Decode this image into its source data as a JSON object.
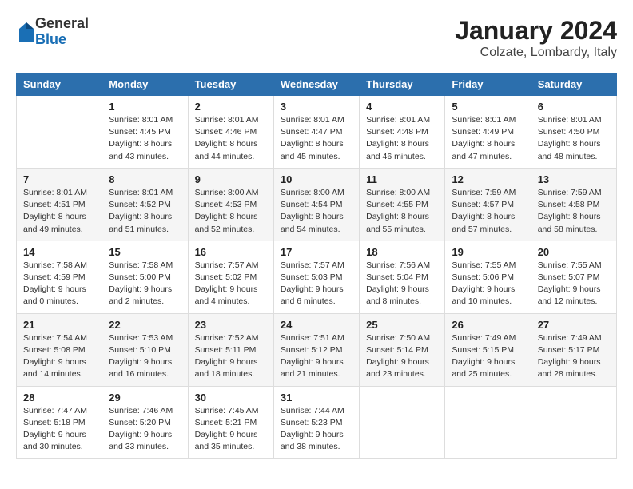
{
  "header": {
    "logo_general": "General",
    "logo_blue": "Blue",
    "title": "January 2024",
    "subtitle": "Colzate, Lombardy, Italy"
  },
  "days_of_week": [
    "Sunday",
    "Monday",
    "Tuesday",
    "Wednesday",
    "Thursday",
    "Friday",
    "Saturday"
  ],
  "weeks": [
    [
      {
        "day": "",
        "info": ""
      },
      {
        "day": "1",
        "info": "Sunrise: 8:01 AM\nSunset: 4:45 PM\nDaylight: 8 hours\nand 43 minutes."
      },
      {
        "day": "2",
        "info": "Sunrise: 8:01 AM\nSunset: 4:46 PM\nDaylight: 8 hours\nand 44 minutes."
      },
      {
        "day": "3",
        "info": "Sunrise: 8:01 AM\nSunset: 4:47 PM\nDaylight: 8 hours\nand 45 minutes."
      },
      {
        "day": "4",
        "info": "Sunrise: 8:01 AM\nSunset: 4:48 PM\nDaylight: 8 hours\nand 46 minutes."
      },
      {
        "day": "5",
        "info": "Sunrise: 8:01 AM\nSunset: 4:49 PM\nDaylight: 8 hours\nand 47 minutes."
      },
      {
        "day": "6",
        "info": "Sunrise: 8:01 AM\nSunset: 4:50 PM\nDaylight: 8 hours\nand 48 minutes."
      }
    ],
    [
      {
        "day": "7",
        "info": "Sunrise: 8:01 AM\nSunset: 4:51 PM\nDaylight: 8 hours\nand 49 minutes."
      },
      {
        "day": "8",
        "info": "Sunrise: 8:01 AM\nSunset: 4:52 PM\nDaylight: 8 hours\nand 51 minutes."
      },
      {
        "day": "9",
        "info": "Sunrise: 8:00 AM\nSunset: 4:53 PM\nDaylight: 8 hours\nand 52 minutes."
      },
      {
        "day": "10",
        "info": "Sunrise: 8:00 AM\nSunset: 4:54 PM\nDaylight: 8 hours\nand 54 minutes."
      },
      {
        "day": "11",
        "info": "Sunrise: 8:00 AM\nSunset: 4:55 PM\nDaylight: 8 hours\nand 55 minutes."
      },
      {
        "day": "12",
        "info": "Sunrise: 7:59 AM\nSunset: 4:57 PM\nDaylight: 8 hours\nand 57 minutes."
      },
      {
        "day": "13",
        "info": "Sunrise: 7:59 AM\nSunset: 4:58 PM\nDaylight: 8 hours\nand 58 minutes."
      }
    ],
    [
      {
        "day": "14",
        "info": "Sunrise: 7:58 AM\nSunset: 4:59 PM\nDaylight: 9 hours\nand 0 minutes."
      },
      {
        "day": "15",
        "info": "Sunrise: 7:58 AM\nSunset: 5:00 PM\nDaylight: 9 hours\nand 2 minutes."
      },
      {
        "day": "16",
        "info": "Sunrise: 7:57 AM\nSunset: 5:02 PM\nDaylight: 9 hours\nand 4 minutes."
      },
      {
        "day": "17",
        "info": "Sunrise: 7:57 AM\nSunset: 5:03 PM\nDaylight: 9 hours\nand 6 minutes."
      },
      {
        "day": "18",
        "info": "Sunrise: 7:56 AM\nSunset: 5:04 PM\nDaylight: 9 hours\nand 8 minutes."
      },
      {
        "day": "19",
        "info": "Sunrise: 7:55 AM\nSunset: 5:06 PM\nDaylight: 9 hours\nand 10 minutes."
      },
      {
        "day": "20",
        "info": "Sunrise: 7:55 AM\nSunset: 5:07 PM\nDaylight: 9 hours\nand 12 minutes."
      }
    ],
    [
      {
        "day": "21",
        "info": "Sunrise: 7:54 AM\nSunset: 5:08 PM\nDaylight: 9 hours\nand 14 minutes."
      },
      {
        "day": "22",
        "info": "Sunrise: 7:53 AM\nSunset: 5:10 PM\nDaylight: 9 hours\nand 16 minutes."
      },
      {
        "day": "23",
        "info": "Sunrise: 7:52 AM\nSunset: 5:11 PM\nDaylight: 9 hours\nand 18 minutes."
      },
      {
        "day": "24",
        "info": "Sunrise: 7:51 AM\nSunset: 5:12 PM\nDaylight: 9 hours\nand 21 minutes."
      },
      {
        "day": "25",
        "info": "Sunrise: 7:50 AM\nSunset: 5:14 PM\nDaylight: 9 hours\nand 23 minutes."
      },
      {
        "day": "26",
        "info": "Sunrise: 7:49 AM\nSunset: 5:15 PM\nDaylight: 9 hours\nand 25 minutes."
      },
      {
        "day": "27",
        "info": "Sunrise: 7:49 AM\nSunset: 5:17 PM\nDaylight: 9 hours\nand 28 minutes."
      }
    ],
    [
      {
        "day": "28",
        "info": "Sunrise: 7:47 AM\nSunset: 5:18 PM\nDaylight: 9 hours\nand 30 minutes."
      },
      {
        "day": "29",
        "info": "Sunrise: 7:46 AM\nSunset: 5:20 PM\nDaylight: 9 hours\nand 33 minutes."
      },
      {
        "day": "30",
        "info": "Sunrise: 7:45 AM\nSunset: 5:21 PM\nDaylight: 9 hours\nand 35 minutes."
      },
      {
        "day": "31",
        "info": "Sunrise: 7:44 AM\nSunset: 5:23 PM\nDaylight: 9 hours\nand 38 minutes."
      },
      {
        "day": "",
        "info": ""
      },
      {
        "day": "",
        "info": ""
      },
      {
        "day": "",
        "info": ""
      }
    ]
  ]
}
